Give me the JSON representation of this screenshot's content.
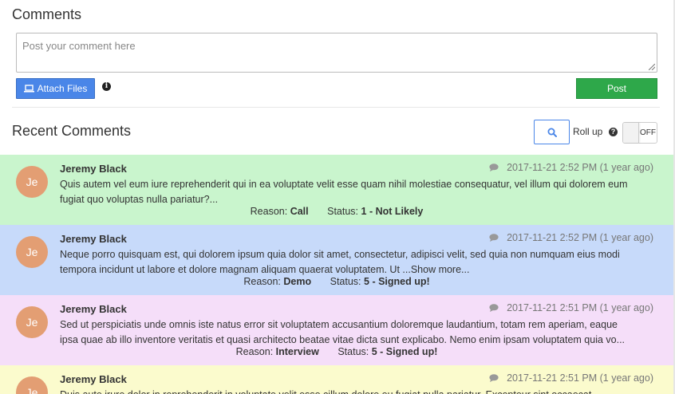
{
  "header": {
    "title": "Comments"
  },
  "composer": {
    "placeholder": "Post your comment here",
    "attach_label": "Attach Files",
    "post_label": "Post"
  },
  "recent": {
    "title": "Recent Comments",
    "rollup_label": "Roll up",
    "toggle_state": "OFF"
  },
  "comments": [
    {
      "avatar_initials": "Je",
      "author": "Jeremy Black",
      "timestamp": "2017-11-21 2:52 PM (1 year ago)",
      "line1": "Quis autem vel eum iure reprehenderit qui in ea voluptate velit esse quam nihil molestiae consequatur, vel illum qui dolorem eum",
      "line2": "fugiat quo voluptas nulla pariatur?...",
      "reason_label": "Reason:",
      "reason_value": "Call",
      "status_label": "Status:",
      "status_value": "1 - Not Likely",
      "bg": "#c9f5cd"
    },
    {
      "avatar_initials": "Je",
      "author": "Jeremy Black",
      "timestamp": "2017-11-21 2:52 PM (1 year ago)",
      "line1": "Neque porro quisquam est, qui dolorem ipsum quia dolor sit amet, consectetur, adipisci velit, sed quia non numquam eius modi",
      "line2": "tempora incidunt ut labore et dolore magnam aliquam quaerat voluptatem. Ut ...Show more...",
      "reason_label": "Reason:",
      "reason_value": "Demo",
      "status_label": "Status:",
      "status_value": "5 - Signed up!",
      "bg": "#c7dafa"
    },
    {
      "avatar_initials": "Je",
      "author": "Jeremy Black",
      "timestamp": "2017-11-21 2:51 PM (1 year ago)",
      "line1": "Sed ut perspiciatis unde omnis iste natus error sit voluptatem accusantium doloremque laudantium, totam rem aperiam, eaque",
      "line2": "ipsa quae ab illo inventore veritatis et quasi architecto beatae vitae dicta sunt explicabo. Nemo enim ipsam voluptatem quia vo...",
      "reason_label": "Reason:",
      "reason_value": "Interview",
      "status_label": "Status:",
      "status_value": "5 - Signed up!",
      "bg": "#f5def9"
    },
    {
      "avatar_initials": "Je",
      "author": "Jeremy Black",
      "timestamp": "2017-11-21 2:51 PM (1 year ago)",
      "line1": "Duis aute irure dolor in reprehenderit in voluptate velit esse cillum dolore eu fugiat nulla pariatur. Excepteur sint occaecat",
      "bg": "#fbfbcd"
    }
  ],
  "colors": {
    "accent": "#4a86e8",
    "post": "#2ea84a",
    "avatar": "#e39e73"
  }
}
